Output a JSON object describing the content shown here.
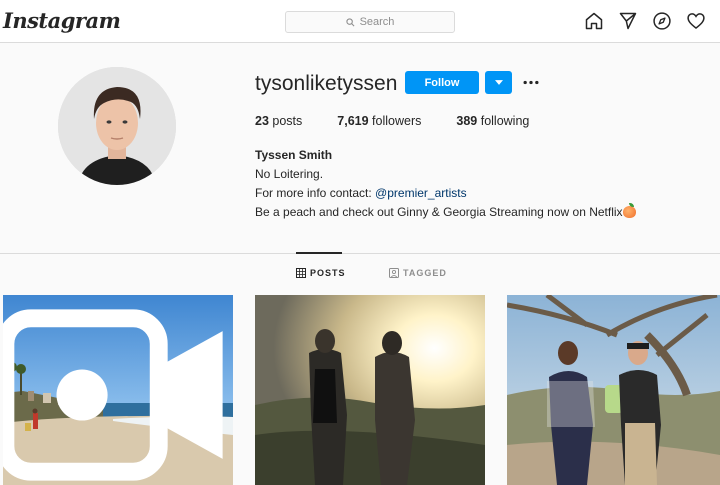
{
  "nav": {
    "logo": "Instagram",
    "search_placeholder": "Search",
    "icons": [
      "home-icon",
      "direct-icon",
      "explore-icon",
      "activity-heart-icon"
    ]
  },
  "profile": {
    "username": "tysonliketyssen",
    "follow_label": "Follow",
    "stats": {
      "posts_count": "23",
      "posts_label": "posts",
      "followers_count": "7,619",
      "followers_label": "followers",
      "following_count": "389",
      "following_label": "following"
    },
    "bio": {
      "full_name": "Tyssen Smith",
      "line1": "No Loitering.",
      "line2_prefix": "For more info contact: ",
      "line2_handle": "@premier_artists",
      "line3": "Be a peach and check out Ginny & Georgia Streaming now on Netflix"
    }
  },
  "tabs": {
    "posts": "POSTS",
    "tagged": "TAGGED",
    "active": "posts"
  },
  "posts": [
    {
      "kind": "video",
      "subject": "beach"
    },
    {
      "kind": "photo",
      "subject": "two men at sunset"
    },
    {
      "kind": "photo",
      "subject": "two men under tree"
    }
  ],
  "colors": {
    "accent": "#0095f6",
    "link": "#00376b",
    "muted": "#8e8e8e",
    "text": "#262626"
  }
}
